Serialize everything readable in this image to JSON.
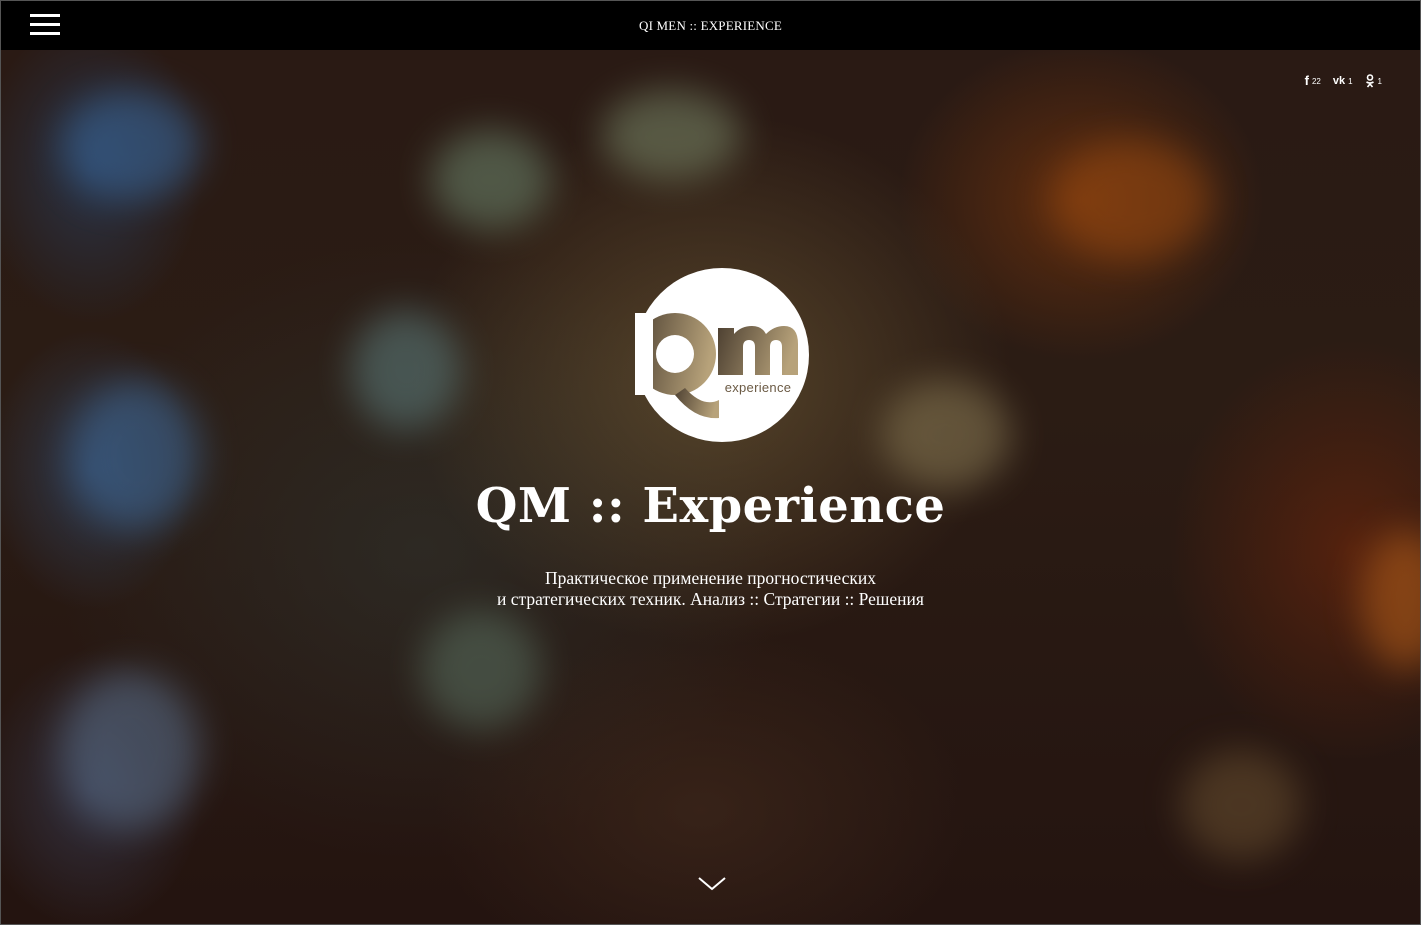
{
  "header": {
    "title": "QI MEN :: EXPERIENCE",
    "menu_icon": "hamburger-menu-icon"
  },
  "social": [
    {
      "icon": "facebook-icon",
      "glyph": "f",
      "count": "22"
    },
    {
      "icon": "vk-icon",
      "glyph": "vk",
      "count": "1"
    },
    {
      "icon": "odnoklassniki-icon",
      "glyph": "ok",
      "count": "1"
    }
  ],
  "hero": {
    "logo": {
      "main": "Qm",
      "sub": "experience"
    },
    "title": "QM :: Experience",
    "subtitle_line1": "Практическое применение прогностических",
    "subtitle_line2": "и стратегических техник. Анализ :: Стратегии :: Решения",
    "scroll_icon": "chevron-down-icon"
  },
  "colors": {
    "topbar": "#000000",
    "text": "#ffffff",
    "logo_gradient_dark": "#5a4a38",
    "logo_gradient_light": "#b8a37a"
  }
}
